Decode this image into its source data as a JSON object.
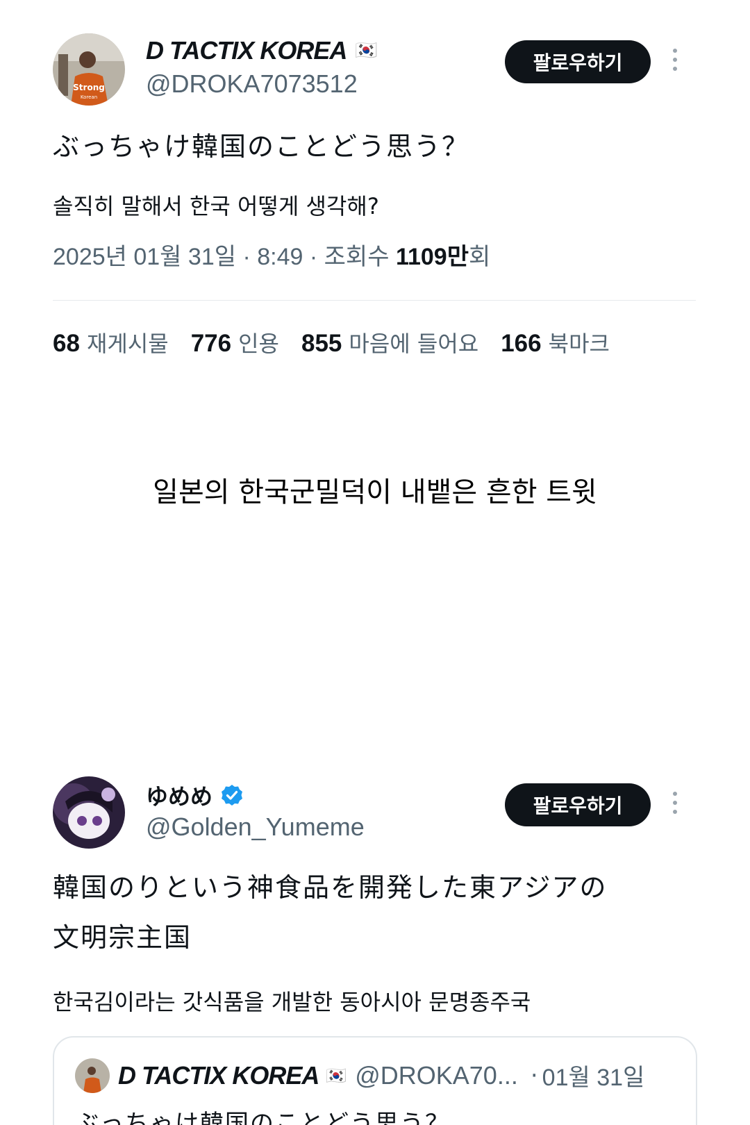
{
  "tweet1": {
    "display_name": "D TACTIX KOREA",
    "flag": "🇰🇷",
    "handle": "@DROKA7073512",
    "follow_label": "팔로우하기",
    "text": "ぶっちゃけ韓国のことどう思う？",
    "translation": "솔직히 말해서 한국 어떻게 생각해?",
    "meta": {
      "date": "2025년 01월 31일",
      "sep1": " · ",
      "time": "8:49",
      "sep2": " · ",
      "views_label": "조회수 ",
      "views_value": "1109만",
      "views_suffix": "회"
    },
    "stats": [
      {
        "value": "68",
        "label": "재게시물"
      },
      {
        "value": "776",
        "label": "인용"
      },
      {
        "value": "855",
        "label": "마음에 들어요"
      },
      {
        "value": "166",
        "label": "북마크"
      }
    ]
  },
  "caption": "일본의 한국군밀덕이 내뱉은 흔한 트윗",
  "tweet2": {
    "display_name": "ゆめめ",
    "handle": "@Golden_Yumeme",
    "follow_label": "팔로우하기",
    "text_line1": "韓国のりという神食品を開発した東アジアの",
    "text_line2": "文明宗主国",
    "translation": "한국김이라는 갓식품을 개발한 동아시아 문명종주국",
    "quote": {
      "display_name": "D TACTIX KOREA",
      "flag": "🇰🇷",
      "handle": "@DROKA70...",
      "dot": "·",
      "date": "01월 31일",
      "text": "ぶっちゃけ韓国のことどう思う？"
    }
  },
  "colors": {
    "text_primary": "#0f1419",
    "text_secondary": "#536471",
    "button_bg": "#0f1419",
    "verified_blue": "#1d9bf0",
    "divider": "#e6e9ec"
  },
  "icons": [
    "more-vertical-icon",
    "verified-badge-icon",
    "korea-flag-icon"
  ]
}
